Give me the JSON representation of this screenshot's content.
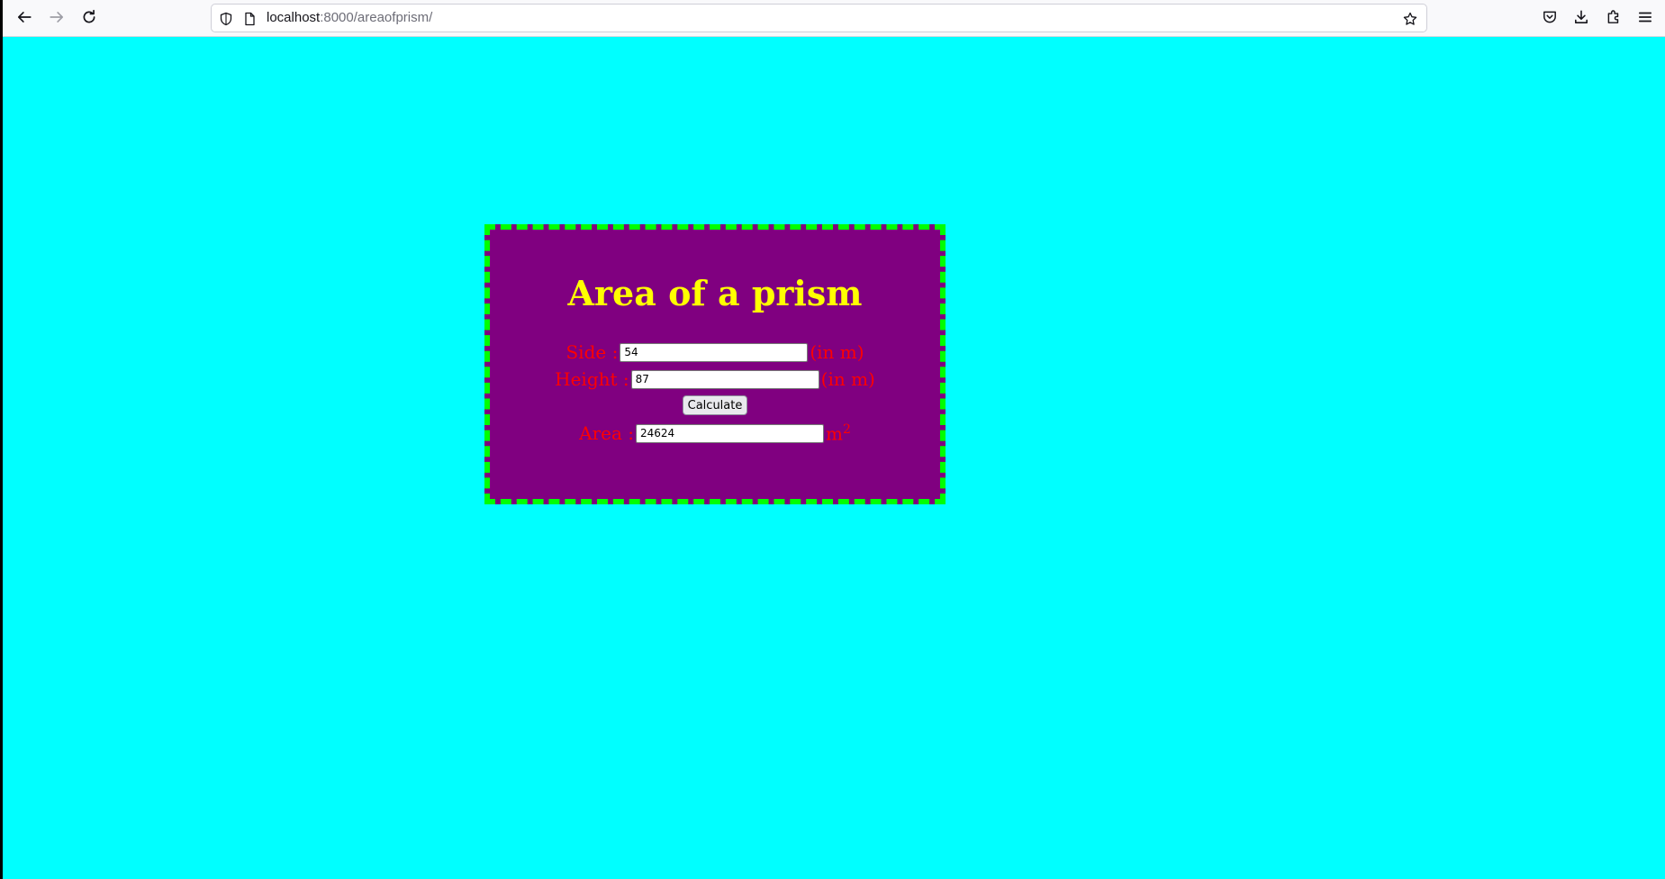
{
  "browser": {
    "url_host": "localhost",
    "url_rest": ":8000/areaofprism/",
    "icons": {
      "back": "arrow-left-icon",
      "forward": "arrow-right-icon",
      "reload": "reload-icon",
      "site_info": "shield-icon",
      "page": "page-icon",
      "bookmark": "star-icon",
      "pocket": "pocket-icon",
      "downloads": "download-icon",
      "extensions": "puzzle-icon",
      "menu": "hamburger-menu-icon"
    }
  },
  "page": {
    "title": "Area of a prism",
    "side": {
      "label": "Side : ",
      "value": "54",
      "unit": "(in m)"
    },
    "height": {
      "label": "Height : ",
      "value": "87",
      "unit": "(in m)"
    },
    "calculate_label": "Calculate",
    "area": {
      "label": "Area : ",
      "value": "24624",
      "unit": "m",
      "unit_exponent": "2"
    },
    "colors": {
      "background": "#00ffff",
      "card": "#800080",
      "border": "#00ff00",
      "title": "#ffff00",
      "labels": "#ff0000"
    }
  }
}
